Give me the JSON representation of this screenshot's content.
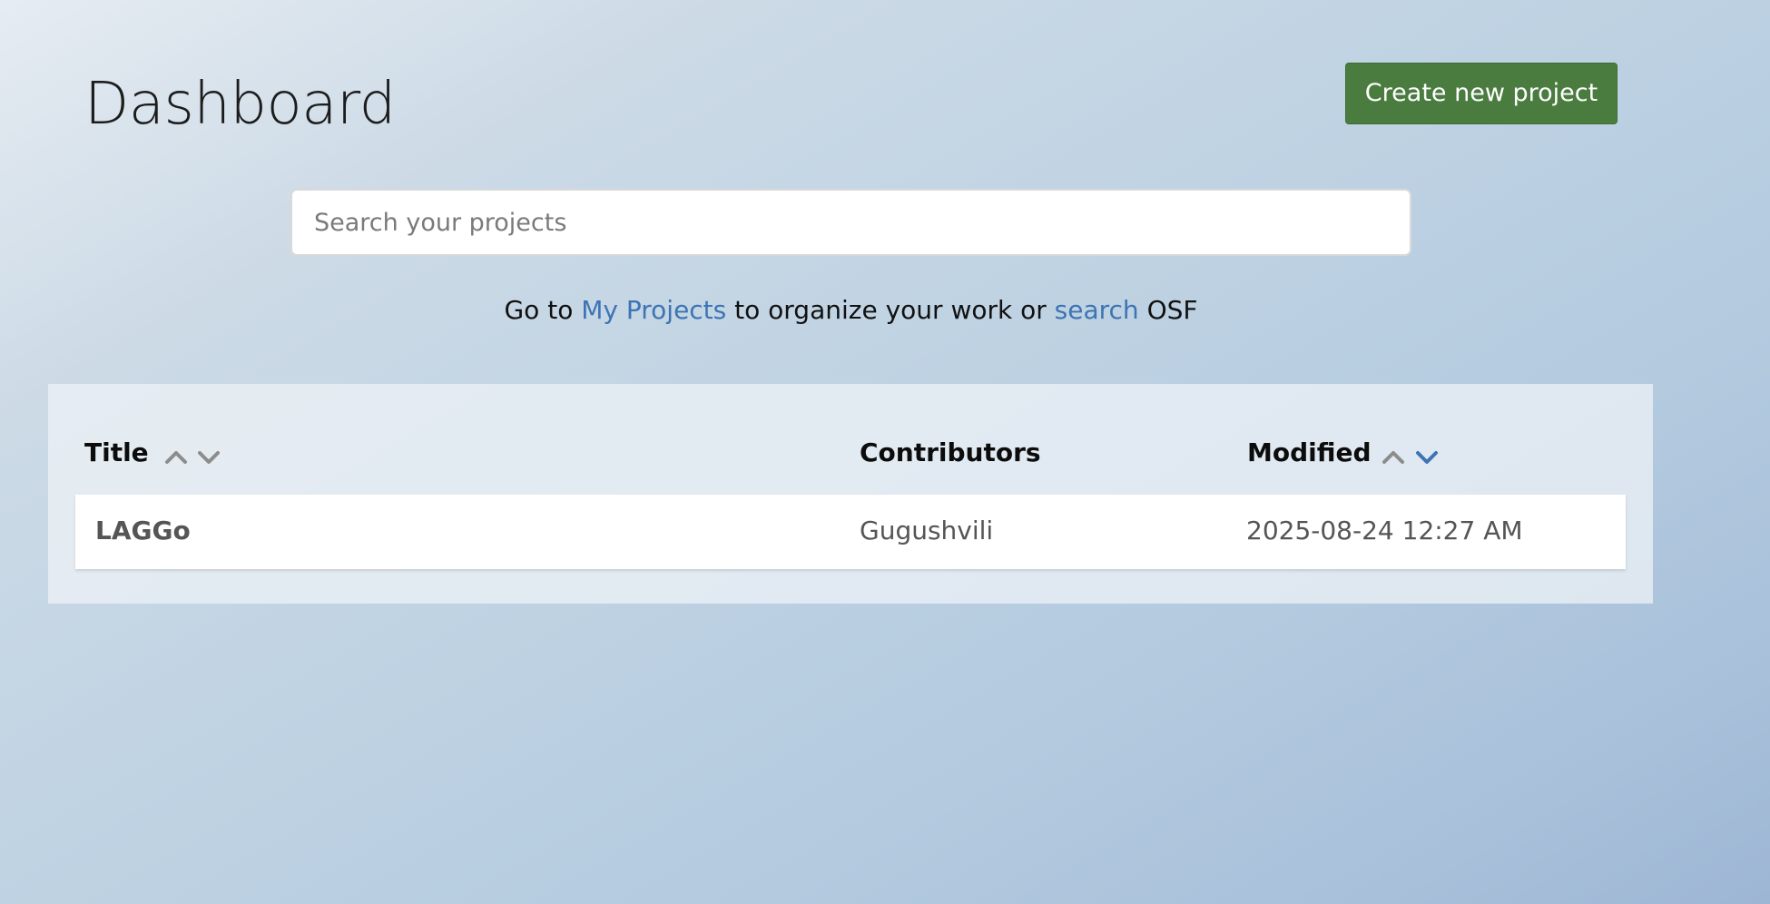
{
  "header": {
    "title": "Dashboard",
    "create_button_label": "Create new project"
  },
  "search": {
    "placeholder": "Search your projects",
    "value": ""
  },
  "goto": {
    "prefix": "Go to ",
    "my_projects_link": "My Projects",
    "middle": " to organize your work or ",
    "search_link": "search",
    "suffix": " OSF"
  },
  "table": {
    "columns": {
      "title": "Title",
      "contributors": "Contributors",
      "modified": "Modified"
    },
    "active_sort": {
      "column": "modified",
      "direction": "descending"
    },
    "rows": [
      {
        "title": "LAGGo",
        "contributors": "Gugushvili",
        "modified": "2025-08-24 12:27 AM"
      }
    ]
  },
  "colors": {
    "primary_button": "#4a7c3f",
    "link": "#3d74b3",
    "sort_inactive": "#8c8c8c",
    "sort_active": "#3d74b3"
  },
  "icons": {
    "sort_asc": "chevron-up-icon",
    "sort_desc": "chevron-down-icon"
  }
}
